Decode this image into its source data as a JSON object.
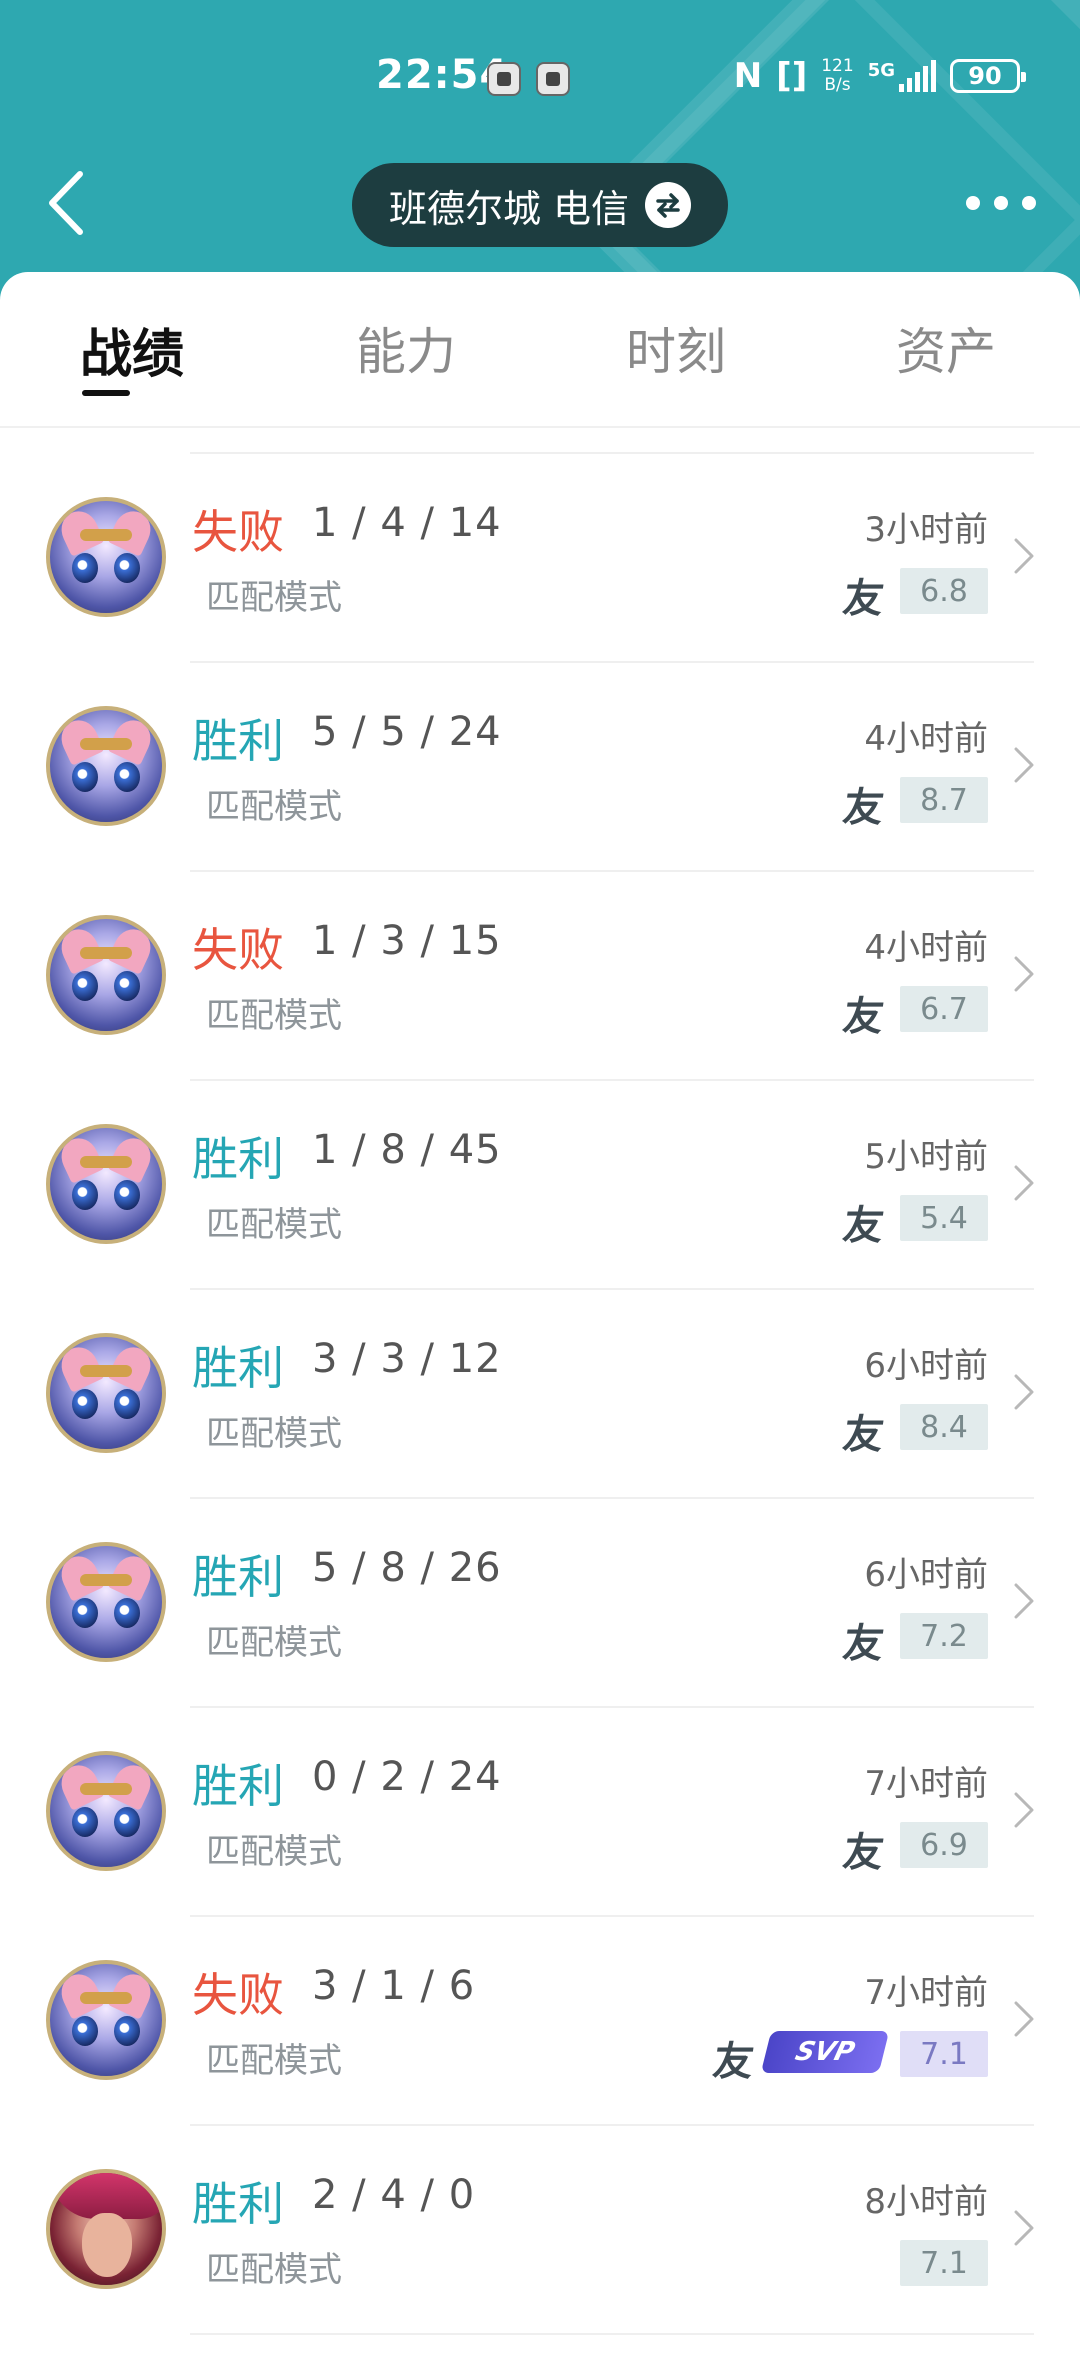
{
  "status_bar": {
    "time": "22:54",
    "nfc_label": "N",
    "vibrate_label": "[]",
    "net_speed_value": "121",
    "net_speed_unit": "B/s",
    "network_type": "5G",
    "battery": "90"
  },
  "header": {
    "server_label": "班德尔城 电信",
    "icons": [
      "back-icon",
      "swap-icon",
      "more-icon"
    ]
  },
  "tabs": [
    {
      "label": "战绩",
      "active": true
    },
    {
      "label": "能力",
      "active": false
    },
    {
      "label": "时刻",
      "active": false
    },
    {
      "label": "资产",
      "active": false
    }
  ],
  "matches": [
    {
      "result": "失败",
      "kda": "1 / 4 / 14",
      "mode": "匹配模式",
      "time": "3小时前",
      "score": "6.8",
      "friend": "友",
      "svp": null
    },
    {
      "result": "胜利",
      "kda": "5 / 5 / 24",
      "mode": "匹配模式",
      "time": "4小时前",
      "score": "8.7",
      "friend": "友",
      "svp": null
    },
    {
      "result": "失败",
      "kda": "1 / 3 / 15",
      "mode": "匹配模式",
      "time": "4小时前",
      "score": "6.7",
      "friend": "友",
      "svp": null
    },
    {
      "result": "胜利",
      "kda": "1 / 8 / 45",
      "mode": "匹配模式",
      "time": "5小时前",
      "score": "5.4",
      "friend": "友",
      "svp": null
    },
    {
      "result": "胜利",
      "kda": "3 / 3 / 12",
      "mode": "匹配模式",
      "time": "6小时前",
      "score": "8.4",
      "friend": "友",
      "svp": null
    },
    {
      "result": "胜利",
      "kda": "5 / 8 / 26",
      "mode": "匹配模式",
      "time": "6小时前",
      "score": "7.2",
      "friend": "友",
      "svp": null
    },
    {
      "result": "胜利",
      "kda": "0 / 2 / 24",
      "mode": "匹配模式",
      "time": "7小时前",
      "score": "6.9",
      "friend": "友",
      "svp": null
    },
    {
      "result": "失败",
      "kda": "3 / 1 / 6",
      "mode": "匹配模式",
      "time": "7小时前",
      "score": "7.1",
      "friend": "友",
      "svp": "SVP"
    },
    {
      "result": "胜利",
      "kda": "2 / 4 / 0",
      "mode": "匹配模式",
      "time": "8小时前",
      "score": "7.1",
      "friend": null,
      "svp": null
    }
  ],
  "colors": {
    "header_bg": "#2ea8b0",
    "win": "#25a6b4",
    "lose": "#e8553f"
  }
}
